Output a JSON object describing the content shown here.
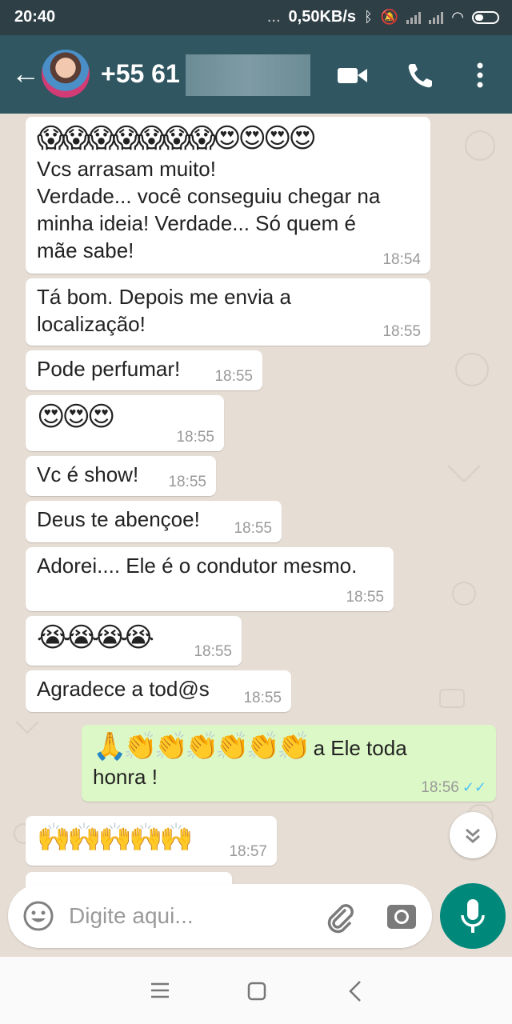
{
  "status_bar": {
    "time": "20:40",
    "dots": "...",
    "speed": "0,50KB/s"
  },
  "header": {
    "phone_prefix": "+55 61"
  },
  "messages": [
    {
      "emoji": "😱😱😱😱😱😱😱😍😍😍😍",
      "text": "Vcs arrasam muito!\nVerdade... você conseguiu chegar na\nminha ideia! Verdade... Só quem é\nmãe sabe!",
      "time": "18:54"
    },
    {
      "text": "Tá bom. Depois me envia a\nlocalização!",
      "time": "18:55"
    },
    {
      "text": "Pode perfumar!",
      "time": "18:55"
    },
    {
      "emoji": "😍😍😍",
      "time": "18:55"
    },
    {
      "text": "Vc é show!",
      "time": "18:55"
    },
    {
      "text": "Deus te abençoe!",
      "time": "18:55"
    },
    {
      "text": "Adorei.... Ele é o condutor mesmo.",
      "time": "18:55"
    },
    {
      "emoji": "😭😭😭😭",
      "time": "18:55"
    },
    {
      "text": "Agradece a tod@s",
      "time": "18:55"
    },
    {
      "emoji": "🙏👏👏👏👏👏👏",
      "text_inline": " a Ele toda",
      "text": "honra !",
      "time": "18:56",
      "checks": "✓✓"
    },
    {
      "emoji": "🙌🙌🙌🙌🙌",
      "time": "18:57"
    }
  ],
  "input": {
    "placeholder": "Digite aqui..."
  },
  "colors": {
    "header": "#2f5661",
    "status_bar": "#2f3f46",
    "outgoing_bubble": "#dcf8c6",
    "incoming_bubble": "#ffffff",
    "mic_button": "#00897b",
    "read_checks": "#4fc3f7"
  },
  "icons": {
    "header": [
      "back-arrow-icon",
      "video-call-icon",
      "phone-icon",
      "more-vert-icon"
    ],
    "input": [
      "emoji-icon",
      "attach-icon",
      "camera-icon",
      "mic-icon"
    ],
    "nav": [
      "menu-icon",
      "home-icon",
      "back-icon"
    ]
  }
}
